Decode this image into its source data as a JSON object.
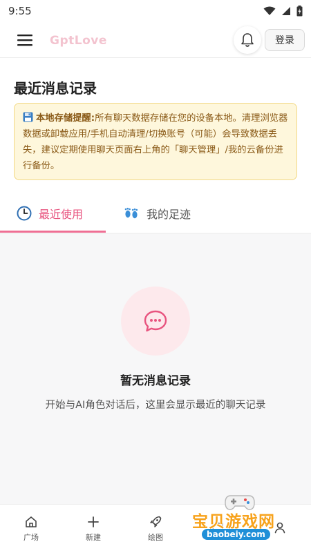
{
  "status_bar": {
    "time": "9:55"
  },
  "app_bar": {
    "brand": "GptLove",
    "login_label": "登录"
  },
  "main": {
    "title": "最近消息记录",
    "notice": {
      "icon": "floppy-disk-icon",
      "bold": "本地存储提醒:",
      "text": "所有聊天数据存储在您的设备本地。清理浏览器数据或卸载应用/手机自动清理/切换账号（可能）会导致数据丢失，建议定期使用聊天页面右上角的「聊天管理」/我的云备份进行备份。"
    },
    "tabs": [
      {
        "label": "最近使用",
        "icon": "clock-icon",
        "active": true
      },
      {
        "label": "我的足迹",
        "icon": "footprints-icon",
        "active": false
      }
    ],
    "empty": {
      "icon": "chat-bubble-icon",
      "title": "暂无消息记录",
      "subtitle": "开始与AI角色对话后，这里会显示最近的聊天记录"
    }
  },
  "bottom_nav": [
    {
      "label": "广场",
      "icon": "home-icon"
    },
    {
      "label": "新建",
      "icon": "plus-icon"
    },
    {
      "label": "绘图",
      "icon": "rocket-icon"
    },
    {
      "label": "",
      "icon": "chat-icon"
    },
    {
      "label": "",
      "icon": "user-icon"
    }
  ],
  "watermark": {
    "text": "宝贝游戏网",
    "url": "baobeiy.com"
  },
  "colors": {
    "accent": "#e8547f",
    "notice_bg": "#fef7dc",
    "notice_text": "#8a5a17"
  }
}
